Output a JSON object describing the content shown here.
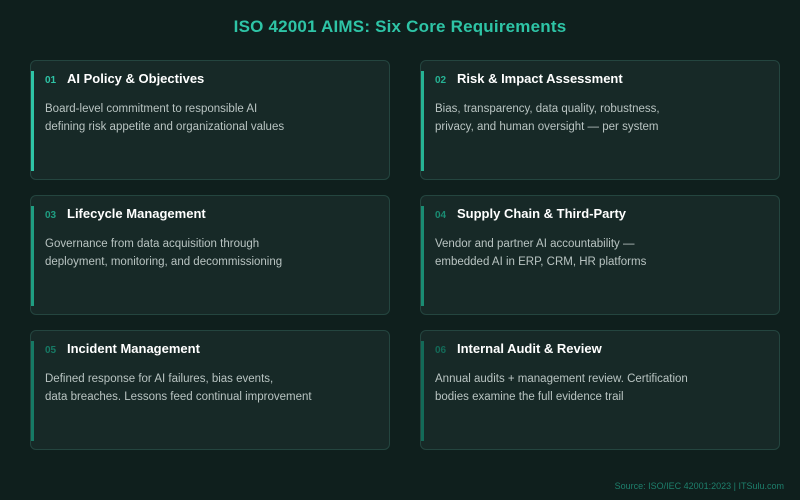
{
  "title": "ISO 42001 AIMS: Six Core Requirements",
  "accent_colors": [
    "#2ec4a6",
    "#26b394",
    "#1f9e82",
    "#1a8c73",
    "#167a65",
    "#136a58"
  ],
  "cards": [
    {
      "num": "01",
      "name": "AI Policy & Objectives",
      "line1": "Board-level commitment to responsible AI",
      "line2": "defining risk appetite and organizational values"
    },
    {
      "num": "02",
      "name": "Risk & Impact Assessment",
      "line1": "Bias, transparency, data quality, robustness,",
      "line2": "privacy, and human oversight — per system"
    },
    {
      "num": "03",
      "name": "Lifecycle Management",
      "line1": "Governance from data acquisition through",
      "line2": "deployment, monitoring, and decommissioning"
    },
    {
      "num": "04",
      "name": "Supply Chain & Third-Party",
      "line1": "Vendor and partner AI accountability —",
      "line2": "embedded AI in ERP, CRM, HR platforms"
    },
    {
      "num": "05",
      "name": "Incident Management",
      "line1": "Defined response for AI failures, bias events,",
      "line2": "data breaches. Lessons feed continual improvement"
    },
    {
      "num": "06",
      "name": "Internal Audit & Review",
      "line1": "Annual audits + management review. Certification",
      "line2": "bodies examine the full evidence trail"
    }
  ],
  "source": "Source: ISO/IEC 42001:2023 | ITSulu.com"
}
